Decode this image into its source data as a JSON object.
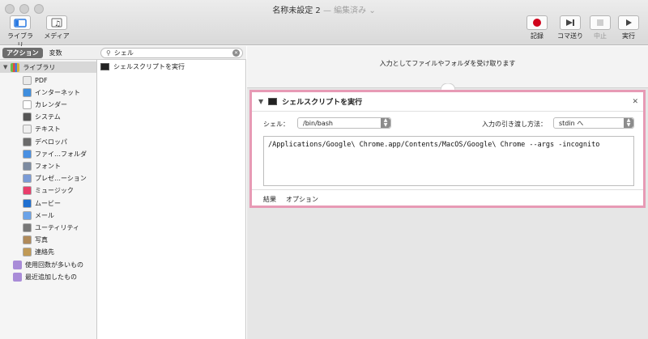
{
  "window": {
    "title": "名称未設定 2",
    "title_suffix": "— 編集済み ⌄"
  },
  "toolbar": {
    "library_label": "ライブラリ",
    "media_label": "メディア",
    "record_label": "記録",
    "step_label": "コマ送り",
    "stop_label": "中止",
    "run_label": "実行"
  },
  "sidebar": {
    "tabs": [
      {
        "label": "アクション",
        "active": true
      },
      {
        "label": "変数",
        "active": false
      }
    ],
    "root_label": "ライブラリ",
    "items": [
      {
        "label": "PDF",
        "icon": "pdf-icon",
        "color": "#e9e9e9"
      },
      {
        "label": "インターネット",
        "icon": "internet-icon",
        "color": "#3f8ede"
      },
      {
        "label": "カレンダー",
        "icon": "calendar-icon",
        "color": "#ffffff"
      },
      {
        "label": "システム",
        "icon": "system-icon",
        "color": "#555555"
      },
      {
        "label": "テキスト",
        "icon": "text-icon",
        "color": "#efefef"
      },
      {
        "label": "デベロッパ",
        "icon": "developer-icon",
        "color": "#6b6b6b"
      },
      {
        "label": "ファイ…フォルダ",
        "icon": "finder-icon",
        "color": "#4a90e2"
      },
      {
        "label": "フォント",
        "icon": "font-icon",
        "color": "#7c8aa0"
      },
      {
        "label": "プレゼ…ーション",
        "icon": "presentation-icon",
        "color": "#7a9bd6"
      },
      {
        "label": "ミュージック",
        "icon": "music-icon",
        "color": "#e93d6b"
      },
      {
        "label": "ムービー",
        "icon": "movie-icon",
        "color": "#1f6fd0"
      },
      {
        "label": "メール",
        "icon": "mail-icon",
        "color": "#6aa2e8"
      },
      {
        "label": "ユーティリティ",
        "icon": "utility-icon",
        "color": "#777777"
      },
      {
        "label": "写真",
        "icon": "photo-icon",
        "color": "#b08a5a"
      },
      {
        "label": "連絡先",
        "icon": "contacts-icon",
        "color": "#c19a55"
      }
    ],
    "smart_folders": [
      {
        "label": "使用回数が多いもの",
        "icon": "smart-folder-icon",
        "color": "#a98cd8"
      },
      {
        "label": "最近追加したもの",
        "icon": "smart-folder-icon",
        "color": "#a98cd8"
      }
    ]
  },
  "search": {
    "value": "シェル"
  },
  "results": [
    {
      "label": "シェルスクリプトを実行"
    }
  ],
  "workflow": {
    "input_text": "入力としてファイルやフォルダを受け取ります",
    "action": {
      "title": "シェルスクリプトを実行",
      "shell_label": "シェル：",
      "shell_value": "/bin/bash",
      "input_label": "入力の引き渡し方法：",
      "input_value": "stdin へ",
      "script": "/Applications/Google\\ Chrome.app/Contents/MacOS/Google\\ Chrome --args -incognito",
      "tabs": [
        "結果",
        "オプション"
      ],
      "highlight_color": "#e79ab5"
    }
  }
}
